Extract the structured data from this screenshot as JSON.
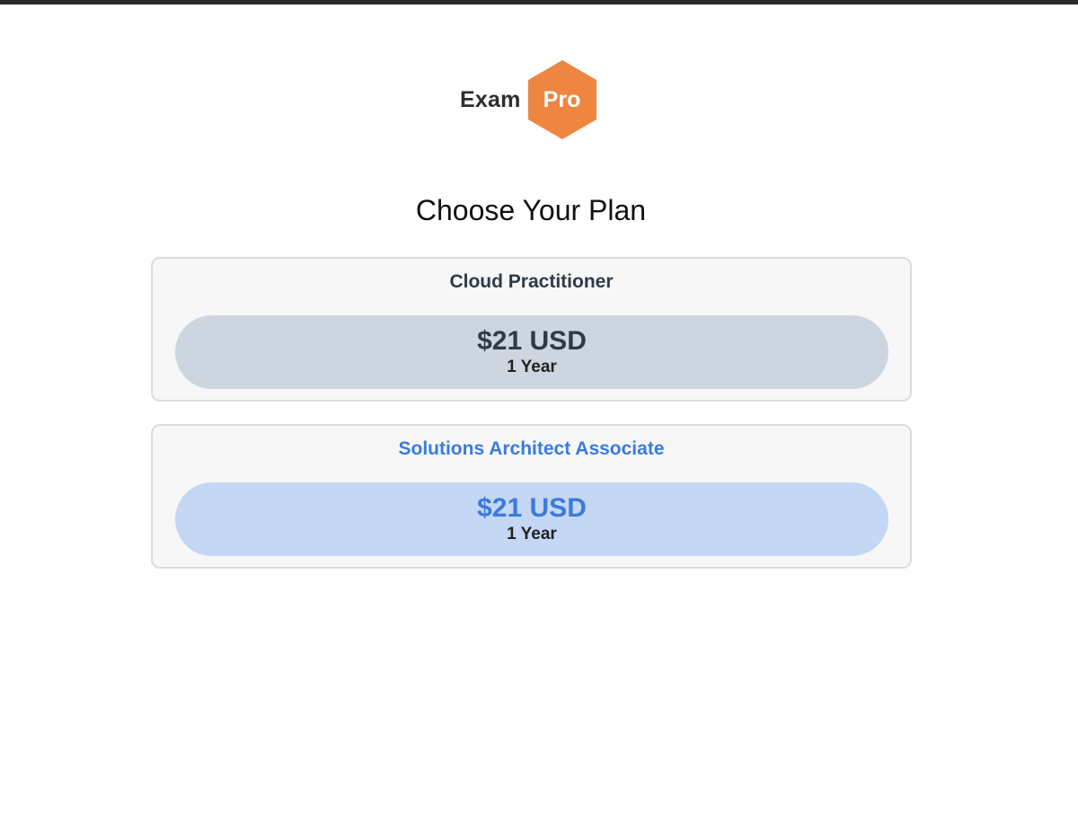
{
  "colors": {
    "brand_orange": "#ee8540",
    "plan_1_accent": "#2f3a48",
    "plan_1_pill": "#cdd6e0",
    "plan_2_accent": "#3b7bdc",
    "plan_2_pill": "#c4d7f5"
  },
  "logo": {
    "text_left": "Exam",
    "text_badge": "Pro",
    "icon": "hexagon-icon"
  },
  "page": {
    "title": "Choose Your Plan"
  },
  "plans": [
    {
      "name": "Cloud Practitioner",
      "price": "$21 USD",
      "duration": "1 Year"
    },
    {
      "name": "Solutions Architect Associate",
      "price": "$21 USD",
      "duration": "1 Year"
    }
  ]
}
